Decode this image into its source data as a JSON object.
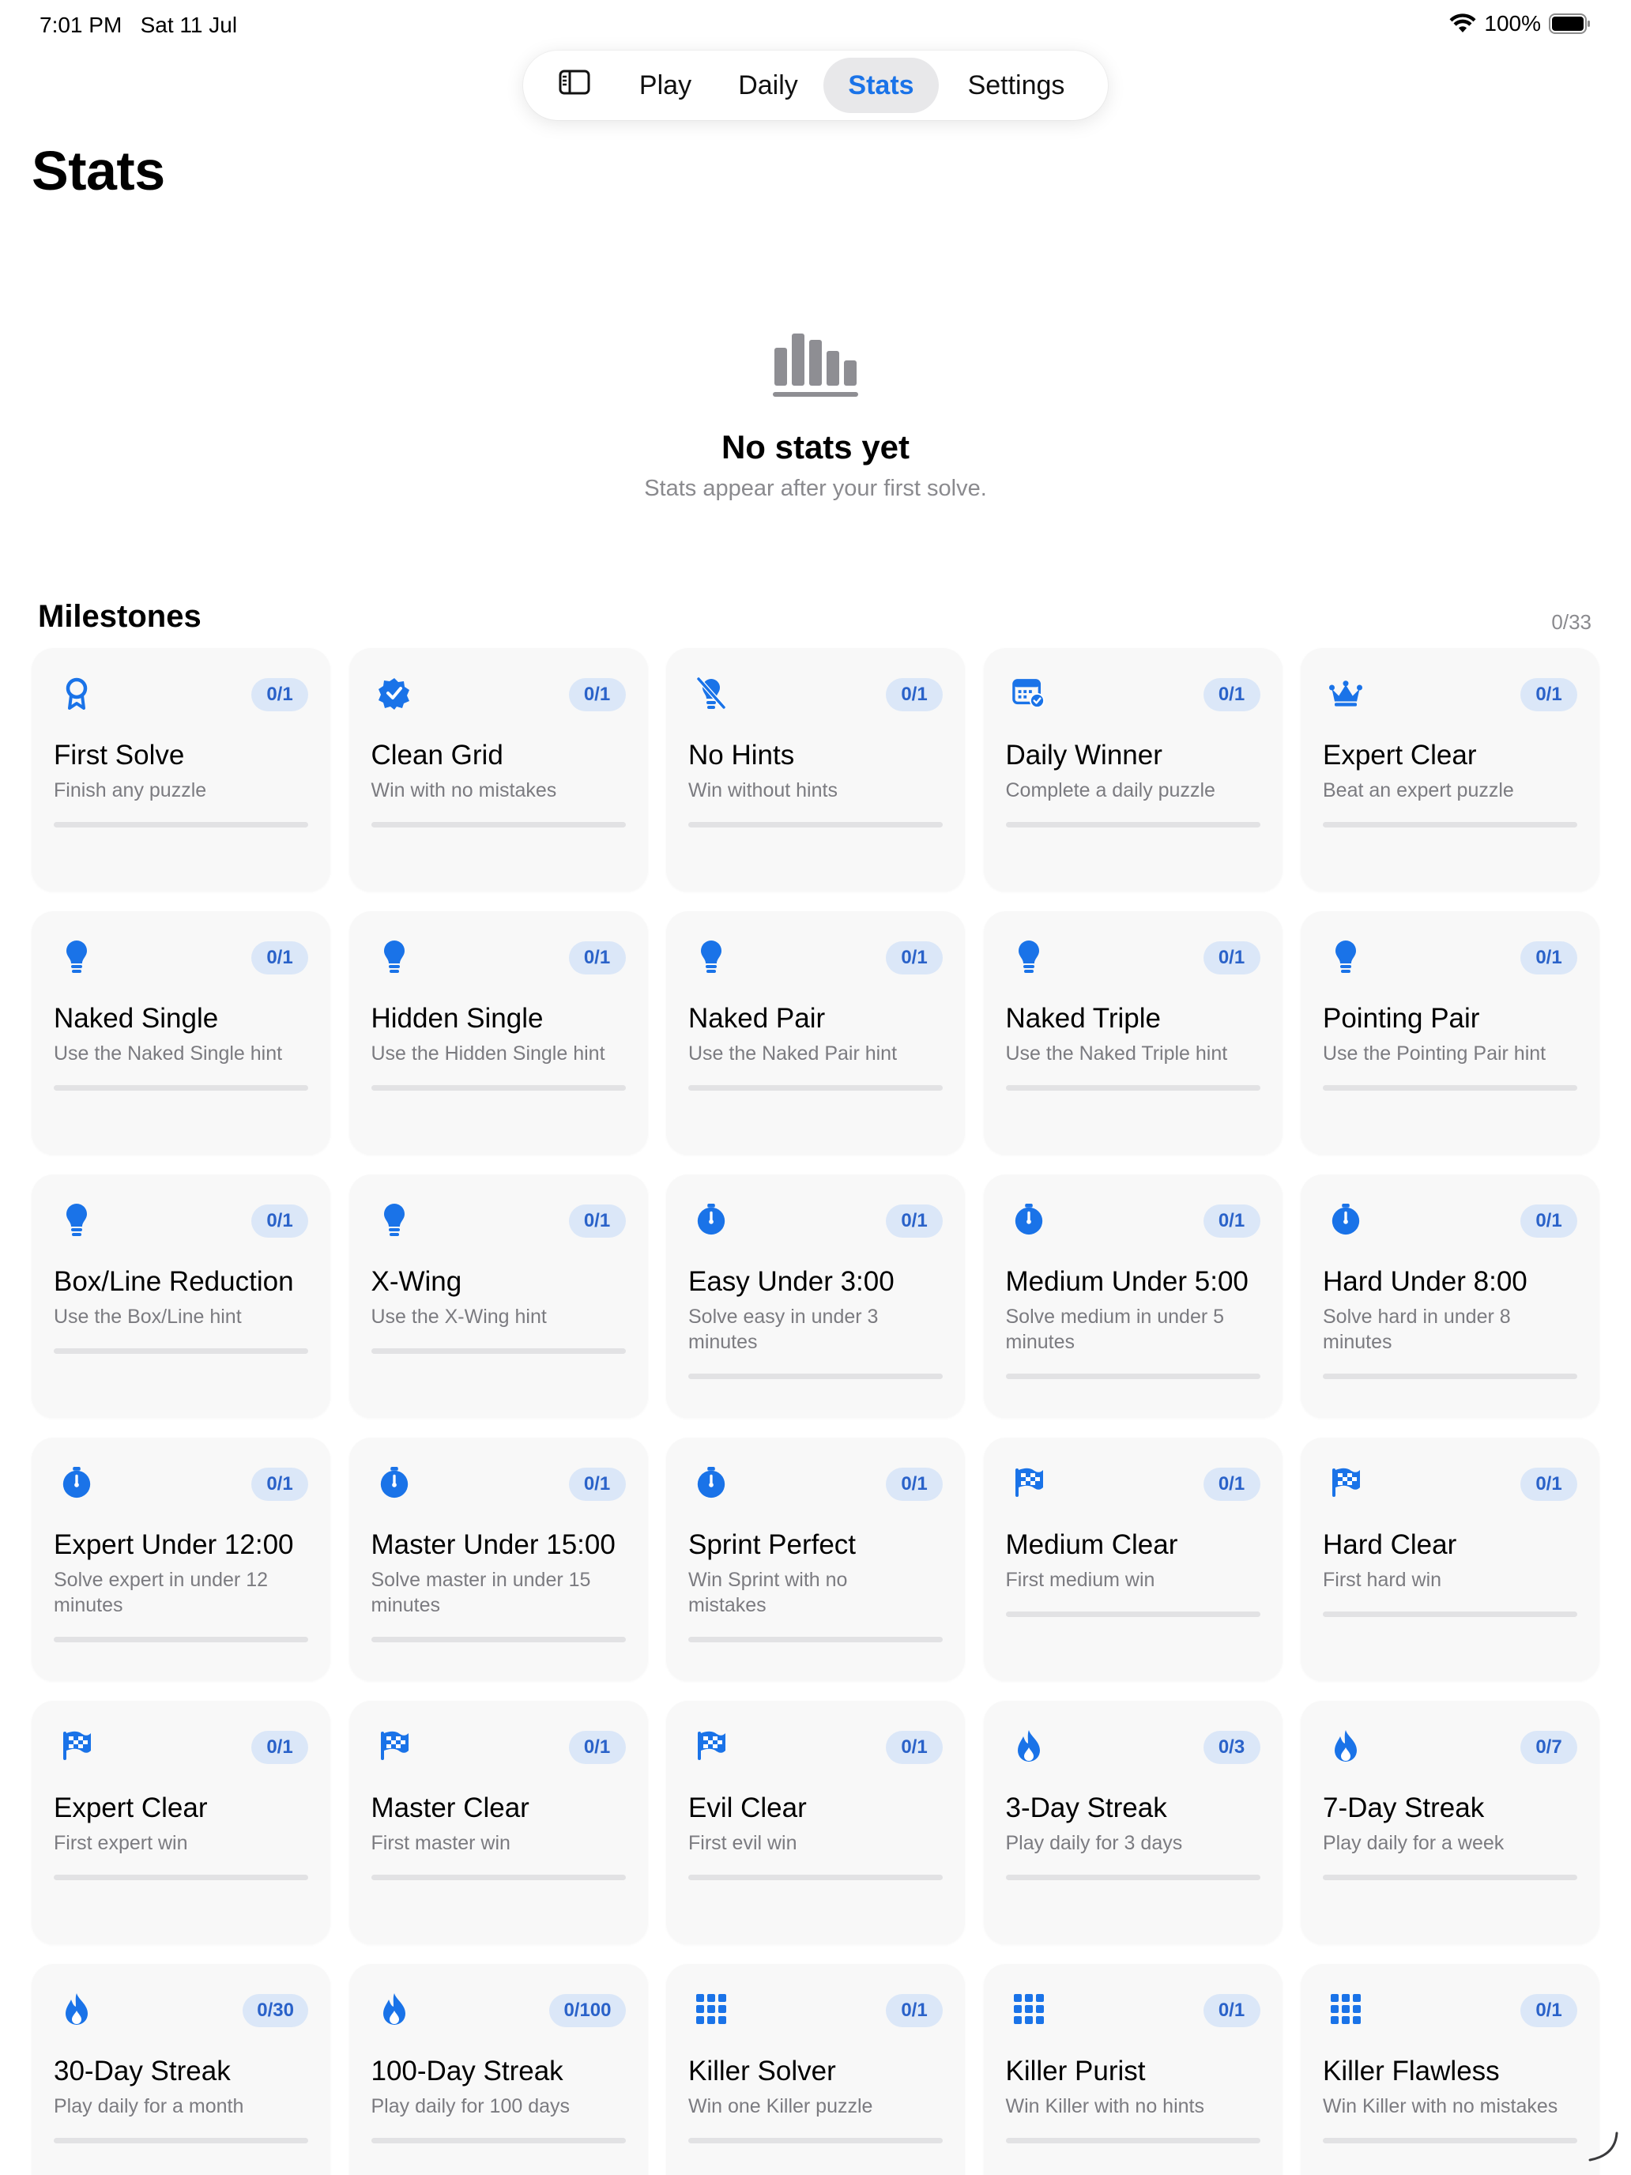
{
  "status_bar": {
    "time": "7:01 PM",
    "date": "Sat 11 Jul",
    "battery": "100%"
  },
  "nav": {
    "sidebar_icon": "sidebar-toggle-icon",
    "tabs": [
      {
        "label": "Play"
      },
      {
        "label": "Daily"
      },
      {
        "label": "Stats",
        "selected": true
      },
      {
        "label": "Settings"
      }
    ]
  },
  "page": {
    "title": "Stats"
  },
  "empty_state": {
    "icon": "bar-chart-icon",
    "title": "No stats yet",
    "subtitle": "Stats appear after your first solve."
  },
  "milestones": {
    "title": "Milestones",
    "count": "0/33",
    "accent": "#1a73e8",
    "items": [
      {
        "icon": "ribbon",
        "badge": "0/1",
        "title": "First Solve",
        "desc": "Finish any puzzle",
        "progress": 0
      },
      {
        "icon": "checkseal",
        "badge": "0/1",
        "title": "Clean Grid",
        "desc": "Win with no mistakes",
        "progress": 0
      },
      {
        "icon": "bulb-slash",
        "badge": "0/1",
        "title": "No Hints",
        "desc": "Win without hints",
        "progress": 0
      },
      {
        "icon": "calendar-check",
        "badge": "0/1",
        "title": "Daily Winner",
        "desc": "Complete a daily puzzle",
        "progress": 0
      },
      {
        "icon": "crown",
        "badge": "0/1",
        "title": "Expert Clear",
        "desc": "Beat an expert puzzle",
        "progress": 0
      },
      {
        "icon": "bulb",
        "badge": "0/1",
        "title": "Naked Single",
        "desc": "Use the Naked Single hint",
        "progress": 0
      },
      {
        "icon": "bulb",
        "badge": "0/1",
        "title": "Hidden Single",
        "desc": "Use the Hidden Single hint",
        "progress": 0
      },
      {
        "icon": "bulb",
        "badge": "0/1",
        "title": "Naked Pair",
        "desc": "Use the Naked Pair hint",
        "progress": 0
      },
      {
        "icon": "bulb",
        "badge": "0/1",
        "title": "Naked Triple",
        "desc": "Use the Naked Triple hint",
        "progress": 0
      },
      {
        "icon": "bulb",
        "badge": "0/1",
        "title": "Pointing Pair",
        "desc": "Use the Pointing Pair hint",
        "progress": 0
      },
      {
        "icon": "bulb",
        "badge": "0/1",
        "title": "Box/Line Reduction",
        "desc": "Use the Box/Line hint",
        "progress": 0
      },
      {
        "icon": "bulb",
        "badge": "0/1",
        "title": "X-Wing",
        "desc": "Use the X-Wing hint",
        "progress": 0
      },
      {
        "icon": "timer",
        "badge": "0/1",
        "title": "Easy Under 3:00",
        "desc": "Solve easy in under 3 minutes",
        "progress": 0
      },
      {
        "icon": "timer",
        "badge": "0/1",
        "title": "Medium Under 5:00",
        "desc": "Solve medium in under 5 minutes",
        "progress": 0
      },
      {
        "icon": "timer",
        "badge": "0/1",
        "title": "Hard Under 8:00",
        "desc": "Solve hard in under 8 minutes",
        "progress": 0
      },
      {
        "icon": "timer",
        "badge": "0/1",
        "title": "Expert Under 12:00",
        "desc": "Solve expert in under 12 minutes",
        "progress": 0
      },
      {
        "icon": "timer",
        "badge": "0/1",
        "title": "Master Under 15:00",
        "desc": "Solve master in under 15 minutes",
        "progress": 0
      },
      {
        "icon": "timer",
        "badge": "0/1",
        "title": "Sprint Perfect",
        "desc": "Win Sprint with no mistakes",
        "progress": 0
      },
      {
        "icon": "flag",
        "badge": "0/1",
        "title": "Medium Clear",
        "desc": "First medium win",
        "progress": 0
      },
      {
        "icon": "flag",
        "badge": "0/1",
        "title": "Hard Clear",
        "desc": "First hard win",
        "progress": 0
      },
      {
        "icon": "flag",
        "badge": "0/1",
        "title": "Expert Clear",
        "desc": "First expert win",
        "progress": 0
      },
      {
        "icon": "flag",
        "badge": "0/1",
        "title": "Master Clear",
        "desc": "First master win",
        "progress": 0
      },
      {
        "icon": "flag",
        "badge": "0/1",
        "title": "Evil Clear",
        "desc": "First evil win",
        "progress": 0
      },
      {
        "icon": "flame",
        "badge": "0/3",
        "title": "3-Day Streak",
        "desc": "Play daily for 3 days",
        "progress": 0
      },
      {
        "icon": "flame",
        "badge": "0/7",
        "title": "7-Day Streak",
        "desc": "Play daily for a week",
        "progress": 0
      },
      {
        "icon": "flame",
        "badge": "0/30",
        "title": "30-Day Streak",
        "desc": "Play daily for a month",
        "progress": 0
      },
      {
        "icon": "flame",
        "badge": "0/100",
        "title": "100-Day Streak",
        "desc": "Play daily for 100 days",
        "progress": 0
      },
      {
        "icon": "grid",
        "badge": "0/1",
        "title": "Killer Solver",
        "desc": "Win one Killer puzzle",
        "progress": 0
      },
      {
        "icon": "grid",
        "badge": "0/1",
        "title": "Killer Purist",
        "desc": "Win Killer with no hints",
        "progress": 0
      },
      {
        "icon": "grid",
        "badge": "0/1",
        "title": "Killer Flawless",
        "desc": "Win Killer with no mistakes",
        "progress": 0
      }
    ]
  }
}
